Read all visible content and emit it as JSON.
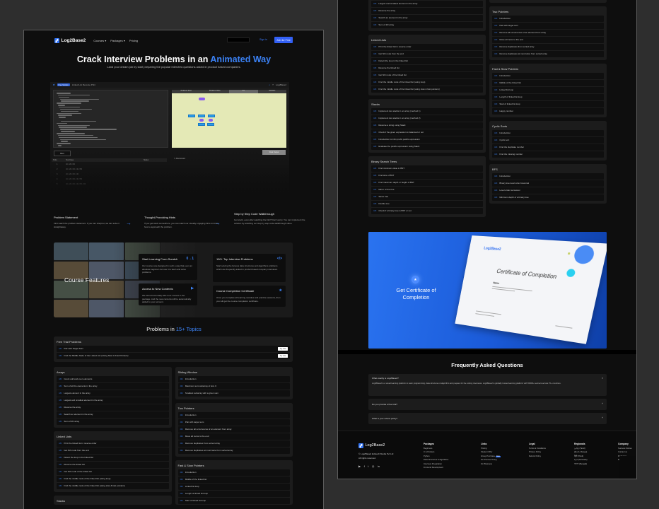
{
  "brand": {
    "name": "Log2Base2",
    "accent": "#3b82f6",
    "button": "#3360f5"
  },
  "nav": {
    "links": [
      "Courses ▾",
      "Packages ▾",
      "Pricing"
    ],
    "signin": "Sign in",
    "join": "Join for Free"
  },
  "hero": {
    "title_main": "Crack Interview Problems in an ",
    "title_highlight": "Animated Way",
    "subtitle": "Land your dream job by start preparing the popular interview questions asked in product based companies."
  },
  "demo": {
    "badge": "Free Version",
    "problem": "Linked List Reverse Print",
    "author": "Log2Base2",
    "tabs": [
      "Problem Stmt",
      "Problem Hints",
      "Viz",
      "Solution"
    ],
    "run": "Run",
    "final_output": "Final Output",
    "discussions": "Discussions",
    "table_headers": [
      "S.No",
      "Test Case",
      "Status"
    ],
    "rows": [
      [
        "1",
        "10->20->30"
      ],
      [
        "2",
        "10->20->30->40->50"
      ],
      [
        "3",
        "10->20->30->40"
      ],
      [
        "4",
        "10->20->30->40->50"
      ],
      [
        "5",
        "10->20->30->40->50->60"
      ]
    ]
  },
  "steps": [
    {
      "title": "Problem Statement",
      "text": "First watch the problem statement. If you can interpret, we can solve it straightaway."
    },
    {
      "title": "Thought-Provoking Hints",
      "text": "If you get stuck somewhere, you can watch our visually engaging hints to know how to approach the problem."
    },
    {
      "title": "Step by Step Code Walkthrough",
      "text": "Got stuck, even after watching the hint? Don't worry. You can implement the solution by watching our step by step code walkthrough video."
    }
  ],
  "features": {
    "title": "Course Features",
    "cards": [
      {
        "title": "Start Learning From Scratch",
        "icon": "0→1",
        "text": "Our courses are designed in such a way that even an absolute beginner can use it to learn and solve problems."
      },
      {
        "title": "150+ Top Interview Problems",
        "icon": "</>",
        "text": "Start solving the famous data structures and algorithms problems which are frequently asked in product based company interviews."
      },
      {
        "title": "Access to New Contents",
        "icon": "▶",
        "text": "We will incrementally add more content in the package. And the new contents will be automatically added to your account."
      },
      {
        "title": "Course Completion Certificate",
        "icon": "★",
        "text": "Once you complete all learning modules and practice sessions, then you will get the course completion certificate."
      }
    ]
  },
  "topics_section": {
    "title_main": "Problems in ",
    "title_highlight": "15+ Topics"
  },
  "free_trial": {
    "title": "Free Trial Problems",
    "try_label": "Try now",
    "items": [
      "Pair with Target Sum",
      "Find the Middle Node of the Linked List (Using Slow & Fast Pointers)"
    ]
  },
  "topics": {
    "left": [
      {
        "title": "Arrays",
        "items": [
          "Count odd and even elements",
          "Sum of all the elements in the array",
          "Largest element in the array",
          "Largest and smallest element in the array",
          "Reverse the array",
          "Search an element in the array",
          "Sum of 2D array"
        ]
      },
      {
        "title": "Linked Lists",
        "items": [
          "Print the linked list in reverse order",
          "Get Nth node from the end",
          "Detect the loop in the linked list",
          "Reverse the linked list",
          "Get Nth node of the linked list",
          "Find the middle node of the linked list (using loop)",
          "Find the middle node of the linked list (using slow & fast pointers)"
        ]
      },
      {
        "title": "Stacks",
        "items": [
          "Implement two stacks in an array (method 1)",
          "Implement two stacks in an array (method 2)",
          "Reverse a string using Stack",
          "Check if the given expression is balanced or not",
          "Introduction to Infix prefix postfix expression",
          "Evaluate the postfix expression using Stack"
        ]
      },
      {
        "title": "Binary Search Trees",
        "items": [
          "Find minimum value in BST",
          "Find size of BST",
          "Find maximum depth or height of BST",
          "Mirror of the tree",
          "Same tree",
          "Double tree",
          "Check if a binary tree is BST or not"
        ]
      }
    ],
    "right": [
      {
        "title": "Sliding Window",
        "items": [
          "Introduction",
          "Maximum sum subarray of size K",
          "Smallest subarray with a given sum"
        ]
      },
      {
        "title": "Two Pointers",
        "items": [
          "Introduction",
          "Pair with target sum",
          "Remove all occurrences of an element from array",
          "Move all zeros to the end",
          "Remove duplicates from sorted array",
          "Remove duplicates at most twice from sorted array"
        ]
      },
      {
        "title": "Fast & Slow Pointers",
        "items": [
          "Introduction",
          "Middle of the linked list",
          "Linked list loop",
          "Length of linked list loop",
          "Start of linked list loop",
          "Happy number"
        ]
      },
      {
        "title": "Cyclic Sorts",
        "items": [
          "Introduction",
          "Cyclic sort",
          "Find the duplicate number",
          "Find the missing number"
        ]
      },
      {
        "title": "BFS",
        "items": [
          "Introduction",
          "Binary tree level order traversal",
          "Level order successor",
          "Minimum depth of a binary tree"
        ]
      }
    ]
  },
  "certificate": {
    "cta": "Get Certificate of Completion",
    "paper_title": "Certificate of Completion",
    "paper_brand": "Log2Base2",
    "paper_name": "Name"
  },
  "faq": {
    "title": "Frequently Asked Questions",
    "items": [
      {
        "q": "What exactly is Log2Base2?",
        "a": "Log2Base2 is a visual learning platform to learn programming, data structures & algorithm and prepare for the coding interviews. Log2Base2 is globally trusted learning platform with 50000+ learners across 70+ countries.",
        "toggle": "×"
      },
      {
        "q": "Do you provide a free trial?",
        "toggle": "+"
      },
      {
        "q": "What is your refund policy?",
        "toggle": "+"
      }
    ]
  },
  "footer": {
    "copyright": "© Log2Base2 Edutech Media Pvt Ltd",
    "rights": "All rights reserved.",
    "socials": [
      "youtube-icon",
      "facebook-icon",
      "twitter-icon",
      "instagram-icon",
      "linkedin-icon"
    ],
    "columns": [
      {
        "title": "Packages",
        "links": [
          "Beginners",
          "C & Pointers",
          "Python",
          "Data Structures & Algorithms",
          "Interview Preparation",
          "Frontend Development"
        ]
      },
      {
        "title": "Links",
        "links": [
          "Pricing",
          "Student Offer",
          "Group Purchase",
          "For Premier Hiring",
          "For Business"
        ],
        "badge": "New"
      },
      {
        "title": "Legal",
        "links": [
          "Terms & Conditions",
          "Privacy Policy",
          "Refund Policy"
        ]
      },
      {
        "title": "Regionals",
        "links": [
          "தமிழ் (Tamil)",
          "తెలుగు (Telugu)",
          "हिंदी (Hindi)",
          "ಕನ್ನಡ (Kannada)",
          "বাংলা (Bengali)"
        ]
      },
      {
        "title": "Company",
        "links": [
          "Success Stories",
          "Contact us",
          "Marketing",
          "Blog"
        ]
      }
    ]
  }
}
